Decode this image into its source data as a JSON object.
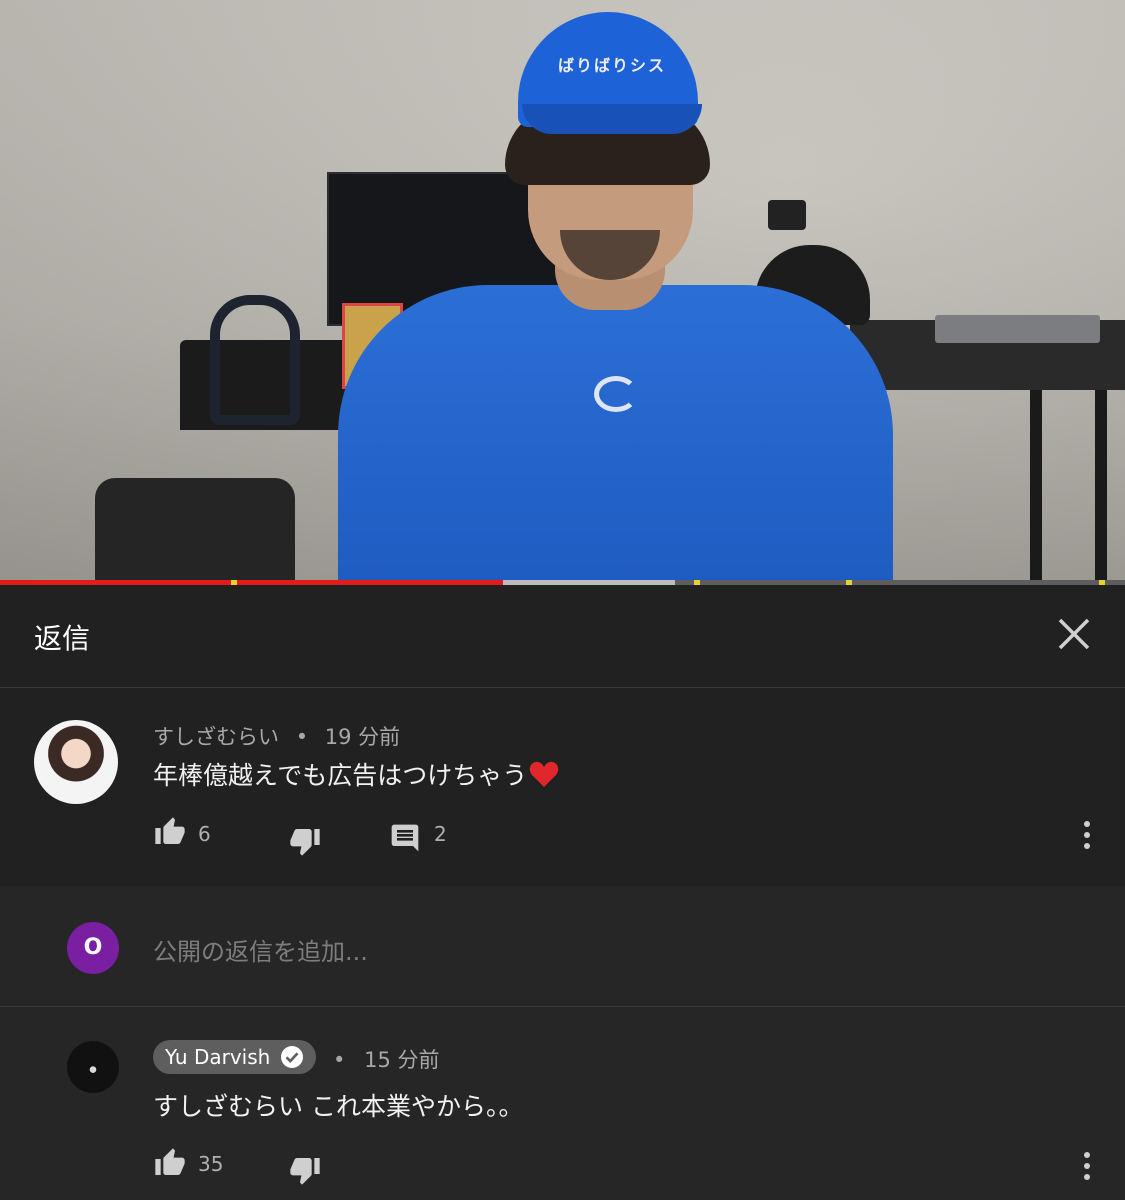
{
  "video": {
    "cap_text": "ばりばりシス",
    "progress": {
      "played_fraction": 0.447,
      "buffered_fraction": 0.6,
      "ad_markers": [
        0.205,
        0.617,
        0.752,
        0.977
      ]
    }
  },
  "panel": {
    "title": "返信"
  },
  "comment": {
    "author": "すしざむらい",
    "separator": "•",
    "time": "19 分前",
    "text": "年棒億越えでも広告はつけちゃう",
    "like_count": "6",
    "reply_count": "2"
  },
  "reply_input": {
    "user_initial": "O",
    "placeholder": "公開の返信を追加..."
  },
  "reply": {
    "author": "Yu Darvish",
    "separator": "•",
    "time": "15 分前",
    "text": "すしざむらい これ本業やから。。",
    "like_count": "35"
  },
  "colors": {
    "background": "#212121",
    "progress_played": "#e31b1b",
    "ad_marker": "#e6d22a",
    "avatar_o": "#7b1fa2",
    "heart": "#e0272b"
  },
  "icons": [
    "close-icon",
    "like-icon",
    "dislike-icon",
    "reply-icon",
    "more-vert-icon",
    "verified-icon",
    "heart-icon"
  ]
}
